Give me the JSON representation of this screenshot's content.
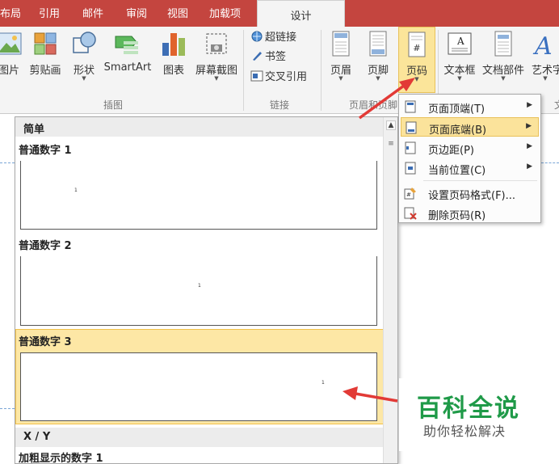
{
  "tabs": [
    {
      "label": "布局"
    },
    {
      "label": "引用"
    },
    {
      "label": "邮件"
    },
    {
      "label": "审阅"
    },
    {
      "label": "视图"
    },
    {
      "label": "加载项"
    },
    {
      "label": "设计"
    }
  ],
  "ribbon": {
    "illustrations": {
      "buttons": [
        {
          "label": "图片"
        },
        {
          "label": "剪贴画"
        },
        {
          "label": "形状"
        },
        {
          "label": "SmartArt"
        },
        {
          "label": "图表"
        },
        {
          "label": "屏幕截图"
        }
      ],
      "group_label": "插图"
    },
    "links": {
      "items": [
        {
          "label": "超链接"
        },
        {
          "label": "书签"
        },
        {
          "label": "交叉引用"
        }
      ],
      "group_label": "链接"
    },
    "header_footer": {
      "buttons": [
        {
          "label": "页眉"
        },
        {
          "label": "页脚"
        },
        {
          "label": "页码"
        }
      ],
      "group_label": "页眉和页脚"
    },
    "text": {
      "buttons": [
        {
          "label": "文本框"
        },
        {
          "label": "文档部件"
        },
        {
          "label": "艺术字"
        }
      ],
      "group_label": "文"
    }
  },
  "gallery": {
    "section_simple": "简单",
    "items": [
      {
        "name": "普通数字 1",
        "preview_number": "1"
      },
      {
        "name": "普通数字 2",
        "preview_number": "1"
      },
      {
        "name": "普通数字 3",
        "preview_number": "1"
      }
    ],
    "section_xy": "X / Y",
    "next_item": "加粗显示的数字 1"
  },
  "menu": {
    "items": [
      {
        "label": "页面顶端(T)",
        "submenu": true
      },
      {
        "label": "页面底端(B)",
        "submenu": true
      },
      {
        "label": "页边距(P)",
        "submenu": true
      },
      {
        "label": "当前位置(C)",
        "submenu": true
      },
      {
        "label": "设置页码格式(F)...",
        "submenu": false
      },
      {
        "label": "删除页码(R)",
        "submenu": false
      }
    ]
  },
  "watermark": {
    "title": "百科全说",
    "subtitle": "助你轻松解决"
  },
  "colors": {
    "tab_bar": "#c4453f",
    "highlight": "#fbe39b",
    "highlight_border": "#e9c15a",
    "arrow": "#e23a36",
    "watermark_green": "#1f9a48"
  }
}
